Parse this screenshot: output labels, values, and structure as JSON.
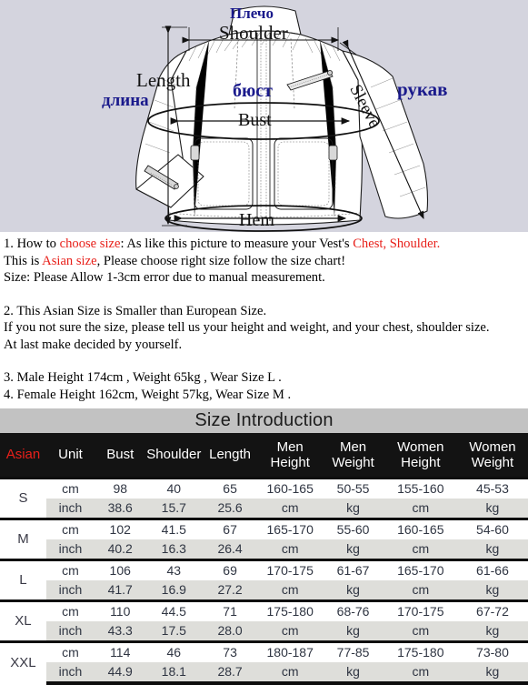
{
  "diagram": {
    "labels": {
      "shoulder_ru": "Плечо",
      "shoulder_en": "Shoulder",
      "length_en": "Length",
      "length_ru": "длина",
      "bust_ru": "бюст",
      "bust_en": "Bust",
      "hem_en": "Hem",
      "sleeve_en": "Sleeve",
      "sleeve_ru": "рукав"
    },
    "background_color": "#d4d4de",
    "label_ru_color": "#1a1a8c",
    "label_en_color": "#111111"
  },
  "notes": {
    "line1_a": "1. How to ",
    "line1_hl1": "choose size",
    "line1_b": ": As like this picture to measure your Vest's ",
    "line1_hl2": "Chest, Shoulder.",
    "line2_a": "This is ",
    "line2_hl": "Asian size",
    "line2_b": ", Please choose right size follow the size chart!",
    "line3": "Size: Please Allow 1-3cm error due to manual measurement.",
    "line4": "2.   This Asian Size is Smaller than European Size.",
    "line5": "If you not sure the size, please tell us your height and weight, and your chest, shoulder size.",
    "line6": "At last make decided by yourself.",
    "line7": "3. Male Height 174cm , Weight 65kg , Wear Size L .",
    "line8": "4. Female Height 162cm, Weight 57kg, Wear Size M .",
    "highlight_color": "#e8201a"
  },
  "table": {
    "title": "Size Introduction",
    "headers": [
      "Asian",
      "Unit",
      "Bust",
      "Shoulder",
      "Length",
      "Men Height",
      "Men Weight",
      "Women Height",
      "Women Weight"
    ],
    "header_asian_color": "#e8201a",
    "rows": [
      {
        "size": "S",
        "cm": {
          "unit": "cm",
          "bust": "98",
          "shoulder": "40",
          "length": "65",
          "men_height": "160-165",
          "men_weight": "50-55",
          "women_height": "155-160",
          "women_weight": "45-53"
        },
        "inch": {
          "unit": "inch",
          "bust": "38.6",
          "shoulder": "15.7",
          "length": "25.6",
          "men_height": "cm",
          "men_weight": "kg",
          "women_height": "cm",
          "women_weight": "kg"
        }
      },
      {
        "size": "M",
        "cm": {
          "unit": "cm",
          "bust": "102",
          "shoulder": "41.5",
          "length": "67",
          "men_height": "165-170",
          "men_weight": "55-60",
          "women_height": "160-165",
          "women_weight": "54-60"
        },
        "inch": {
          "unit": "inch",
          "bust": "40.2",
          "shoulder": "16.3",
          "length": "26.4",
          "men_height": "cm",
          "men_weight": "kg",
          "women_height": "cm",
          "women_weight": "kg"
        }
      },
      {
        "size": "L",
        "cm": {
          "unit": "cm",
          "bust": "106",
          "shoulder": "43",
          "length": "69",
          "men_height": "170-175",
          "men_weight": "61-67",
          "women_height": "165-170",
          "women_weight": "61-66"
        },
        "inch": {
          "unit": "inch",
          "bust": "41.7",
          "shoulder": "16.9",
          "length": "27.2",
          "men_height": "cm",
          "men_weight": "kg",
          "women_height": "cm",
          "women_weight": "kg"
        }
      },
      {
        "size": "XL",
        "cm": {
          "unit": "cm",
          "bust": "110",
          "shoulder": "44.5",
          "length": "71",
          "men_height": "175-180",
          "men_weight": "68-76",
          "women_height": "170-175",
          "women_weight": "67-72"
        },
        "inch": {
          "unit": "inch",
          "bust": "43.3",
          "shoulder": "17.5",
          "length": "28.0",
          "men_height": "cm",
          "men_weight": "kg",
          "women_height": "cm",
          "women_weight": "kg"
        }
      },
      {
        "size": "XXL",
        "cm": {
          "unit": "cm",
          "bust": "114",
          "shoulder": "46",
          "length": "73",
          "men_height": "180-187",
          "men_weight": "77-85",
          "women_height": "175-180",
          "women_weight": "73-80"
        },
        "inch": {
          "unit": "inch",
          "bust": "44.9",
          "shoulder": "18.1",
          "length": "28.7",
          "men_height": "cm",
          "men_weight": "kg",
          "women_height": "cm",
          "women_weight": "kg"
        }
      }
    ]
  }
}
